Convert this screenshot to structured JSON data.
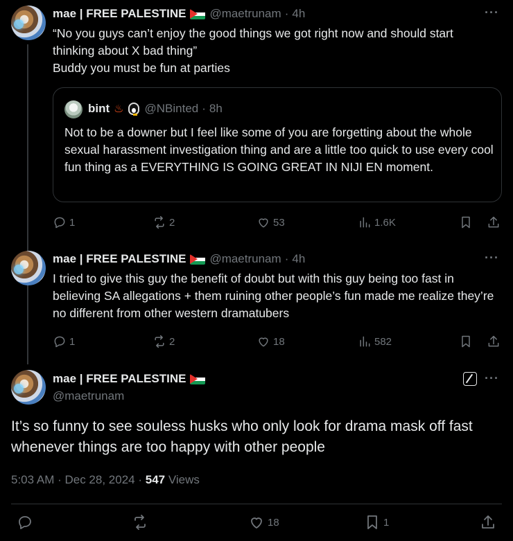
{
  "post1": {
    "name": "mae | FREE PALESTINE",
    "handle": "@maetrunam",
    "time": "4h",
    "text_lines": [
      "“No you guys can’t enjoy the good things we got right now and should start",
      "thinking about X bad thing”",
      "Buddy you must be fun at parties"
    ],
    "quote": {
      "name": "bint",
      "emoji_hot": "♨",
      "handle": "@NBinted",
      "time": "8h",
      "text": "Not to be a downer but I feel like some of you are forgetting about the whole sexual harassment investigation thing and are a little too quick to use every cool fun thing as a EVERYTHING IS GOING GREAT IN NIJI EN moment."
    },
    "replies": "1",
    "reposts": "2",
    "likes": "53",
    "views": "1.6K"
  },
  "post2": {
    "name": "mae | FREE PALESTINE",
    "handle": "@maetrunam",
    "time": "4h",
    "text": "I tried to give this guy the benefit of doubt but with this guy being too fast in believing SA allegations + them ruining other people’s fun made me realize they’re no different from other western dramatubers",
    "replies": "1",
    "reposts": "2",
    "likes": "18",
    "views": "582"
  },
  "main_post": {
    "name": "mae | FREE PALESTINE",
    "handle": "@maetrunam",
    "text": "It’s so funny to see souless husks who only look for drama mask off fast whenever things are too happy with other people",
    "timestamp": "5:03 AM · Dec 28, 2024 ·",
    "views_count": "547",
    "views_label": "Views",
    "likes": "18",
    "bookmarks": "1"
  },
  "ui": {
    "more": "···",
    "dot": "·"
  }
}
